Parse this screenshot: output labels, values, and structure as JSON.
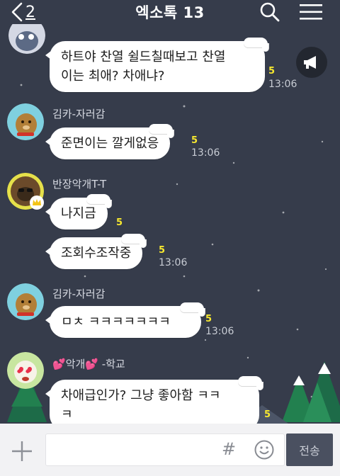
{
  "header": {
    "back_count": "2",
    "title": "엑소톡 13"
  },
  "messages": [
    {
      "sender": "",
      "text": "하트야 찬열 쉴드칠때보고 찬열\n이는 최애? 차애냐?",
      "unread": "5",
      "time": "13:06"
    },
    {
      "sender": "김카-자러감",
      "text": "준면이는 깔게없응",
      "unread": "5",
      "time": "13:06"
    },
    {
      "sender": "반장악개T-T",
      "text": "나지금",
      "unread": "5",
      "time": ""
    },
    {
      "sender": "",
      "text": "조회수조작중",
      "unread": "5",
      "time": "13:06"
    },
    {
      "sender": "김카-자러감",
      "text": "ㅁㅊ ㅋㅋㅋㅋㅋㅋㅋ",
      "unread": "5",
      "time": "13:06"
    },
    {
      "sender": "💕악개💕 -학교",
      "text": "차애급인가? 그냥 좋아함 ㅋㅋ\nㅋ",
      "unread": "5",
      "time": ""
    }
  ],
  "composer": {
    "hash": "#",
    "send_label": "전송"
  },
  "icons": {
    "back": "chevron-left-icon",
    "search": "search-icon",
    "menu": "hamburger-menu-icon",
    "megaphone": "megaphone-icon",
    "plus": "plus-icon",
    "emoji": "smiley-icon"
  },
  "colors": {
    "background": "#363c4b",
    "bubble": "#ffffff",
    "unread": "#f7e82f",
    "send_button": "#4a5060"
  }
}
